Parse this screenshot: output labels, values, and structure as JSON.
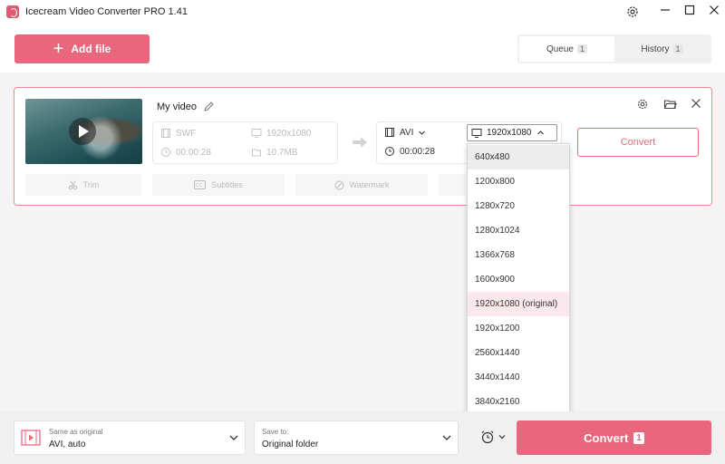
{
  "app": {
    "title": "Icecream Video Converter PRO 1.41"
  },
  "toolbar": {
    "add_file_label": "Add file"
  },
  "tabs": [
    {
      "label": "Queue",
      "count": "1",
      "active": true
    },
    {
      "label": "History",
      "count": "1",
      "active": false
    }
  ],
  "file": {
    "name": "My video",
    "source": {
      "format": "SWF",
      "resolution": "1920x1080",
      "duration": "00:00:28",
      "size": "10.7MB"
    },
    "target": {
      "format": "AVI",
      "resolution": "1920x1080",
      "duration": "00:00:28"
    },
    "convert_label": "Convert",
    "actions": [
      {
        "label": "Trim",
        "icon": "scissors-icon"
      },
      {
        "label": "Subtitles",
        "icon": "cc-icon"
      },
      {
        "label": "Watermark",
        "icon": "watermark-icon"
      }
    ]
  },
  "resolution_menu": {
    "options": [
      "640x480",
      "1200x800",
      "1280x720",
      "1280x1024",
      "1366x768",
      "1600x900",
      "1920x1080 (original)",
      "1920x1200",
      "2560x1440",
      "3440x1440",
      "3840x2160"
    ],
    "hovered": "640x480",
    "selected": "1920x1080 (original)"
  },
  "bottom": {
    "format_sub": "Same as original",
    "format_main": "AVI, auto",
    "save_sub": "Save to:",
    "save_main": "Original folder",
    "convert_label": "Convert",
    "convert_count": "1"
  },
  "colors": {
    "accent": "#e8677c",
    "accent_light": "#fbe8ec",
    "border_highlight": "#e88a9a"
  }
}
